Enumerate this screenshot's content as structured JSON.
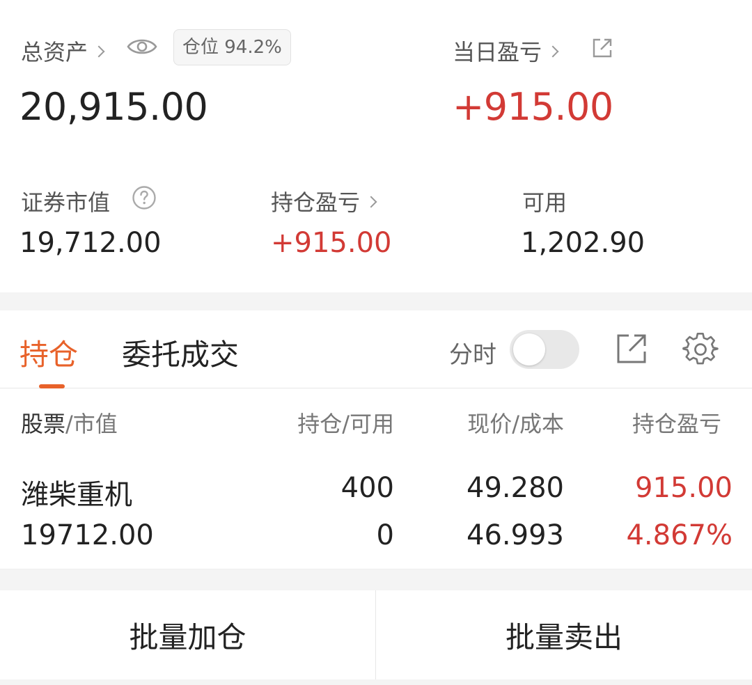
{
  "summary": {
    "total_assets_label": "总资产",
    "position_badge": "仓位 94.2%",
    "total_assets_value": "20,915.00",
    "daily_pnl_label": "当日盈亏",
    "daily_pnl_value": "+915.00",
    "market_value_label": "证券市值",
    "market_value": "19,712.00",
    "holding_pnl_label": "持仓盈亏",
    "holding_pnl_value": "+915.00",
    "available_label": "可用",
    "available_value": "1,202.90"
  },
  "tabs": {
    "active": "持仓",
    "other": "委托成交",
    "toggle_label": "分时"
  },
  "table": {
    "headers": {
      "stock": "股票",
      "stock_sub": "/市值",
      "qty": "持仓/可用",
      "price": "现价/成本",
      "pnl": "持仓盈亏"
    },
    "rows": [
      {
        "name": "潍柴重机",
        "market_value": "19712.00",
        "holding": "400",
        "available": "0",
        "price": "49.280",
        "cost": "46.993",
        "pnl": "915.00",
        "pnl_pct": "4.867%"
      }
    ]
  },
  "actions": {
    "batch_add": "批量加仓",
    "batch_sell": "批量卖出"
  },
  "colors": {
    "accent": "#e8622a",
    "profit": "#d23a35"
  },
  "icons": [
    "chevron-right-icon",
    "eye-icon",
    "external-link-icon",
    "help-circle-icon",
    "gear-icon"
  ]
}
